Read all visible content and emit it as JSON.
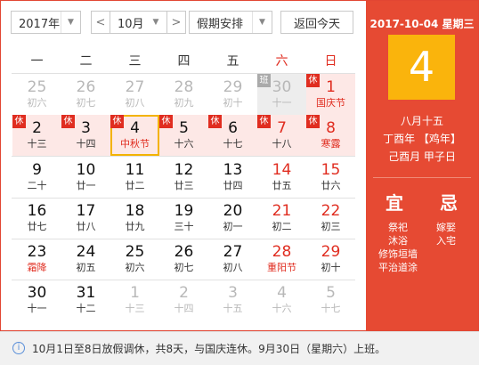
{
  "toolbar": {
    "year": "2017年",
    "month": "10月",
    "holiday": "假期安排",
    "today": "返回今天",
    "prev": "<",
    "next": ">",
    "dropdown_arrow": "▼"
  },
  "weekdays": [
    "一",
    "二",
    "三",
    "四",
    "五",
    "六",
    "日"
  ],
  "weeks": [
    [
      {
        "num": "25",
        "sub": "初六",
        "dim": true
      },
      {
        "num": "26",
        "sub": "初七",
        "dim": true
      },
      {
        "num": "27",
        "sub": "初八",
        "dim": true
      },
      {
        "num": "28",
        "sub": "初九",
        "dim": true
      },
      {
        "num": "29",
        "sub": "初十",
        "dim": true
      },
      {
        "num": "30",
        "sub": "十一",
        "dim": true,
        "work": true,
        "tag": "班"
      },
      {
        "num": "1",
        "sub": "国庆节",
        "we": true,
        "fest": true,
        "hol": true,
        "tag": "休"
      }
    ],
    [
      {
        "num": "2",
        "sub": "十三",
        "hol": true,
        "tag": "休"
      },
      {
        "num": "3",
        "sub": "十四",
        "hol": true,
        "tag": "休"
      },
      {
        "num": "4",
        "sub": "中秋节",
        "fest": true,
        "hol": true,
        "tag": "休",
        "selected": true
      },
      {
        "num": "5",
        "sub": "十六",
        "hol": true,
        "tag": "休"
      },
      {
        "num": "6",
        "sub": "十七",
        "hol": true,
        "tag": "休"
      },
      {
        "num": "7",
        "sub": "十八",
        "we": true,
        "hol": true,
        "tag": "休"
      },
      {
        "num": "8",
        "sub": "寒露",
        "we": true,
        "fest": true,
        "hol": true,
        "tag": "休"
      }
    ],
    [
      {
        "num": "9",
        "sub": "二十"
      },
      {
        "num": "10",
        "sub": "廿一"
      },
      {
        "num": "11",
        "sub": "廿二"
      },
      {
        "num": "12",
        "sub": "廿三"
      },
      {
        "num": "13",
        "sub": "廿四"
      },
      {
        "num": "14",
        "sub": "廿五",
        "we": true
      },
      {
        "num": "15",
        "sub": "廿六",
        "we": true
      }
    ],
    [
      {
        "num": "16",
        "sub": "廿七"
      },
      {
        "num": "17",
        "sub": "廿八"
      },
      {
        "num": "18",
        "sub": "廿九"
      },
      {
        "num": "19",
        "sub": "三十"
      },
      {
        "num": "20",
        "sub": "初一"
      },
      {
        "num": "21",
        "sub": "初二",
        "we": true
      },
      {
        "num": "22",
        "sub": "初三",
        "we": true
      }
    ],
    [
      {
        "num": "23",
        "sub": "霜降",
        "fest": true
      },
      {
        "num": "24",
        "sub": "初五"
      },
      {
        "num": "25",
        "sub": "初六"
      },
      {
        "num": "26",
        "sub": "初七"
      },
      {
        "num": "27",
        "sub": "初八"
      },
      {
        "num": "28",
        "sub": "重阳节",
        "we": true,
        "fest": true
      },
      {
        "num": "29",
        "sub": "初十",
        "we": true
      }
    ],
    [
      {
        "num": "30",
        "sub": "十一"
      },
      {
        "num": "31",
        "sub": "十二"
      },
      {
        "num": "1",
        "sub": "十三",
        "dim": true
      },
      {
        "num": "2",
        "sub": "十四",
        "dim": true
      },
      {
        "num": "3",
        "sub": "十五",
        "dim": true
      },
      {
        "num": "4",
        "sub": "十六",
        "dim": true
      },
      {
        "num": "5",
        "sub": "十七",
        "dim": true
      }
    ]
  ],
  "side": {
    "date": "2017-10-04 星期三",
    "day": "4",
    "lunar": "八月十五",
    "ganzhi_year": "丁酉年 【鸡年】",
    "ganzhi_month_day": "己酉月 甲子日",
    "yi_label": "宜",
    "ji_label": "忌",
    "yi_items": [
      "祭祀",
      "沐浴",
      "修饰垣墙",
      "平治道涂"
    ],
    "ji_items": [
      "嫁娶",
      "入宅"
    ]
  },
  "info": {
    "icon": "info-icon",
    "text": "10月1日至8日放假调休，共8天，与国庆连休。9月30日（星期六）上班。"
  },
  "colors": {
    "accent": "#e64a33",
    "holiday_red": "#e02d20",
    "today_box": "#fab40c",
    "holiday_bg": "#fde8e6"
  }
}
